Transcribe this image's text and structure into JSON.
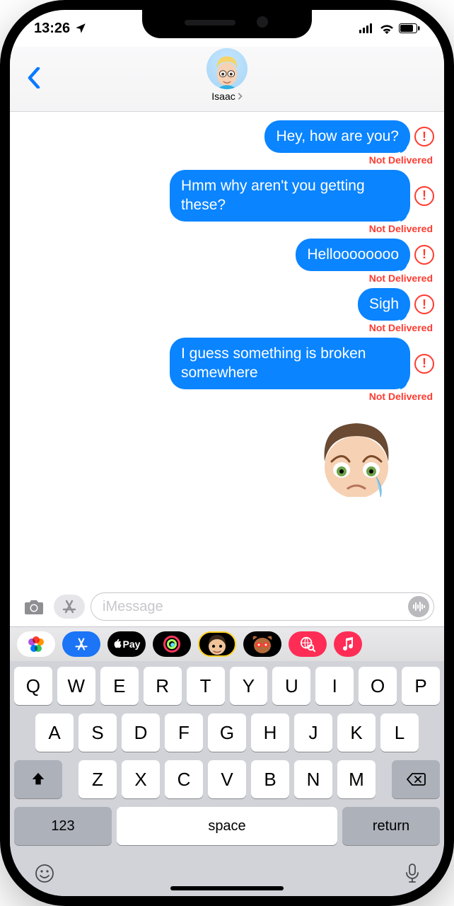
{
  "status_bar": {
    "time": "13:26"
  },
  "header": {
    "contact_name": "Isaac"
  },
  "compose": {
    "placeholder": "iMessage"
  },
  "app_strip": {
    "pay_label": "Pay"
  },
  "error_label": "Not Delivered",
  "messages": [
    {
      "text": "Hey, how are you?"
    },
    {
      "text": "Hmm why aren't you getting these?"
    },
    {
      "text": "Helloooooooo"
    },
    {
      "text": "Sigh"
    },
    {
      "text": "I guess something is broken somewhere"
    }
  ],
  "keyboard": {
    "row1": [
      "Q",
      "W",
      "E",
      "R",
      "T",
      "Y",
      "U",
      "I",
      "O",
      "P"
    ],
    "row2": [
      "A",
      "S",
      "D",
      "F",
      "G",
      "H",
      "J",
      "K",
      "L"
    ],
    "row3": [
      "Z",
      "X",
      "C",
      "V",
      "B",
      "N",
      "M"
    ],
    "numbers_label": "123",
    "space_label": "space",
    "return_label": "return"
  }
}
